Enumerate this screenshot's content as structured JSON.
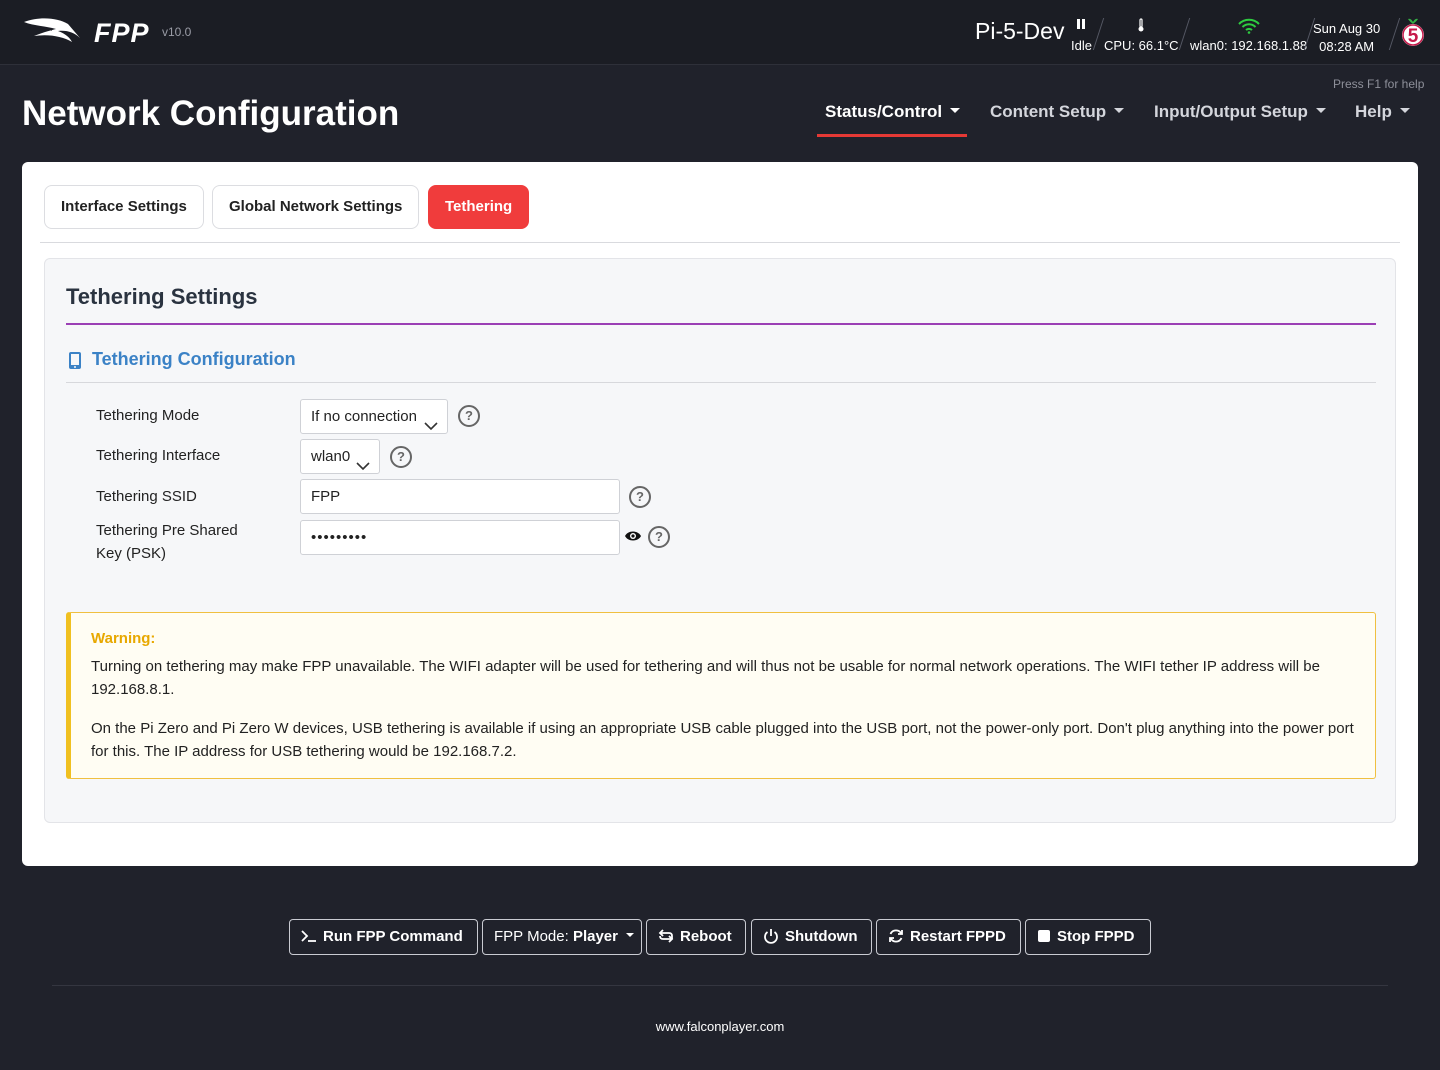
{
  "header": {
    "brand": "FPP",
    "version": "v10.0",
    "hostname": "Pi-5-Dev",
    "status": "Idle",
    "cpu": "CPU: 66.1°C",
    "network": "wlan0: 192.168.1.88",
    "date": "Sun Aug 30",
    "time": "08:28 AM",
    "pi_model": "5"
  },
  "help_hint": "Press F1 for help",
  "page_title": "Network Configuration",
  "nav": {
    "items": [
      {
        "label": "Status/Control",
        "active": true
      },
      {
        "label": "Content Setup",
        "active": false
      },
      {
        "label": "Input/Output Setup",
        "active": false
      },
      {
        "label": "Help",
        "active": false
      }
    ]
  },
  "tabs": [
    {
      "label": "Interface Settings",
      "active": false
    },
    {
      "label": "Global Network Settings",
      "active": false
    },
    {
      "label": "Tethering",
      "active": true
    }
  ],
  "panel": {
    "title": "Tethering Settings",
    "section_title": "Tethering Configuration",
    "fields": {
      "mode": {
        "label": "Tethering Mode",
        "value": "If no connection"
      },
      "interface": {
        "label": "Tethering Interface",
        "value": "wlan0"
      },
      "ssid": {
        "label": "Tethering SSID",
        "value": "FPP"
      },
      "psk": {
        "label": "Tethering Pre Shared Key (PSK)",
        "label_line1": "Tethering Pre Shared",
        "label_line2": "Key (PSK)",
        "value": "•••••••••"
      }
    },
    "warning": {
      "title": "Warning:",
      "p1": "Turning on tethering may make FPP unavailable. The WIFI adapter will be used for tethering and will thus not be usable for normal network operations. The WIFI tether IP address will be 192.168.8.1.",
      "p2": "On the Pi Zero and Pi Zero W devices, USB tethering is available if using an appropriate USB cable plugged into the USB port, not the power-only port. Don't plug anything into the power port for this. The IP address for USB tethering would be 192.168.7.2."
    }
  },
  "footer": {
    "buttons": {
      "run_command": "Run FPP Command",
      "mode_prefix": "FPP Mode:",
      "mode_value": "Player",
      "reboot": "Reboot",
      "shutdown": "Shutdown",
      "restart": "Restart FPPD",
      "stop": "Stop FPPD"
    },
    "url": "www.falconplayer.com"
  },
  "colors": {
    "accent_red": "#f03c3c",
    "section_blue": "#3b82c6",
    "divider_purple": "#9b3fb5",
    "warning_yellow": "#f0c020",
    "background_dark": "#20222b"
  },
  "icons": [
    "falcon-logo-icon",
    "pause-icon",
    "thermometer-icon",
    "wifi-icon",
    "raspberry-pi-icon",
    "chevron-down-icon",
    "help-icon",
    "eye-icon",
    "tablet-icon",
    "terminal-icon",
    "reboot-icon",
    "power-icon",
    "refresh-icon",
    "stop-icon"
  ]
}
